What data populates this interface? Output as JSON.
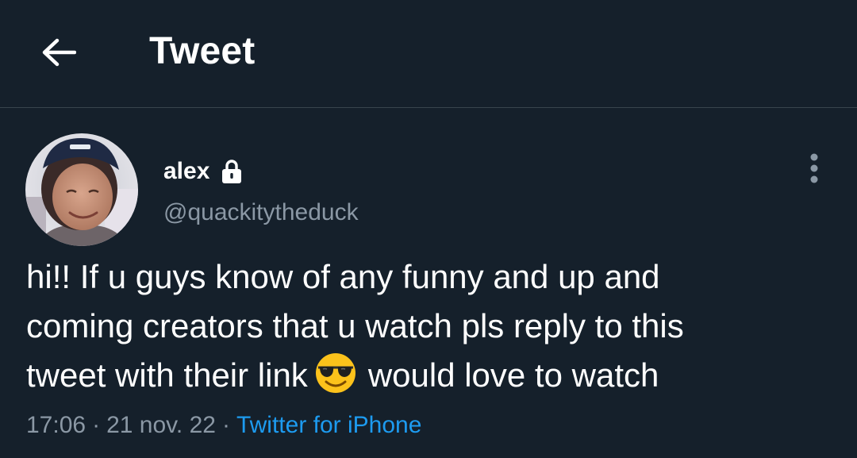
{
  "header": {
    "title": "Tweet",
    "back_icon": "arrow-left-icon"
  },
  "tweet": {
    "author": {
      "name": "alex",
      "handle": "@quackitytheduck",
      "protected_icon": "lock-icon",
      "avatar": "profile-photo"
    },
    "more_icon": "more-vertical-icon",
    "text_lines": [
      "hi!! If u guys know of any funny and up and",
      "coming creators that u watch pls reply to this",
      "tweet with their link",
      "would love to watch"
    ],
    "emoji": "smiling-face-with-sunglasses",
    "time": "17:06",
    "date": "21 nov. 22",
    "separator": "·",
    "source": "Twitter for iPhone"
  },
  "colors": {
    "background": "#15202b",
    "divider": "#38444d",
    "secondary_text": "#8b98a5",
    "link": "#1d9bf0"
  }
}
